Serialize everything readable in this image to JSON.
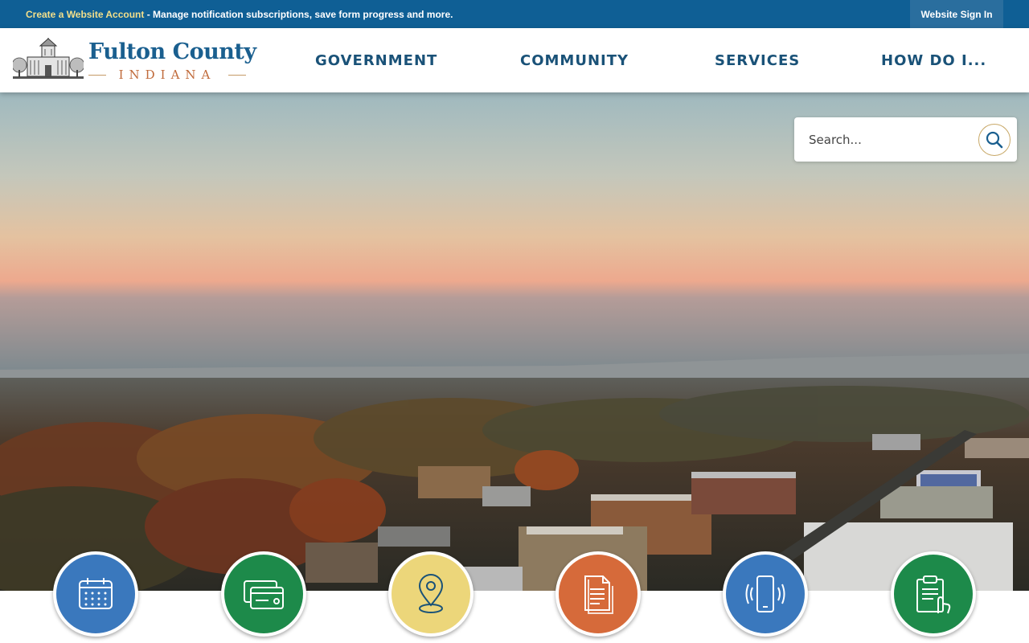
{
  "topbar": {
    "create_account_link": "Create a Website Account",
    "message": " - Manage notification subscriptions, save form progress and more.",
    "sign_in": "Website Sign In"
  },
  "logo": {
    "title": "Fulton County",
    "subtitle": "INDIANA"
  },
  "nav": {
    "items": [
      {
        "label": "GOVERNMENT"
      },
      {
        "label": "COMMUNITY"
      },
      {
        "label": "SERVICES"
      },
      {
        "label": "HOW DO I..."
      }
    ]
  },
  "search": {
    "placeholder": "Search..."
  },
  "quick_links": [
    {
      "icon": "calendar-icon",
      "color": "#3a78bd"
    },
    {
      "icon": "credit-card-icon",
      "color": "#1d8a4a"
    },
    {
      "icon": "map-pin-icon",
      "color": "#ecd67a"
    },
    {
      "icon": "document-icon",
      "color": "#d66a3a"
    },
    {
      "icon": "mobile-phone-icon",
      "color": "#3a78bd"
    },
    {
      "icon": "clipboard-icon",
      "color": "#1d8a4a"
    }
  ],
  "colors": {
    "topbar": "#0f5f95",
    "nav_text": "#1a5278",
    "logo_blue": "#1a5f8f",
    "logo_orange": "#c06a3a"
  }
}
